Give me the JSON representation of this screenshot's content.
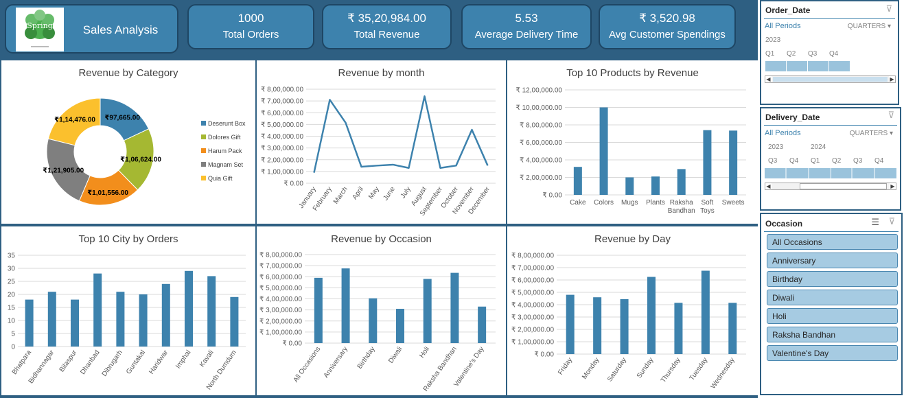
{
  "header": {
    "title": "Sales Analysis",
    "logo_text": "Spring"
  },
  "kpis": [
    {
      "value": "1000",
      "label": "Total Orders"
    },
    {
      "value": "₹ 35,20,984.00",
      "label": "Total Revenue"
    },
    {
      "value": "5.53",
      "label": "Average Delivery Time"
    },
    {
      "value": "₹ 3,520.98",
      "label": "Avg Customer Spendings"
    }
  ],
  "colors": {
    "accent": "#3d82ad",
    "background": "#2e5f82",
    "series": "#3d82ad"
  },
  "chart_data": [
    {
      "id": "revenue-by-category",
      "type": "pie",
      "title": "Revenue by Category",
      "categories": [
        "Deserunt Box",
        "Dolores Gift",
        "Harum Pack",
        "Magnam Set",
        "Quia Gift"
      ],
      "values": [
        97665,
        106624,
        101556,
        121905,
        114476
      ],
      "data_labels": [
        "₹97,665.00",
        "₹1,06,624.00",
        "₹1,01,556.00",
        "₹1,21,905.00",
        "₹1,14,476.00"
      ],
      "colors": [
        "#3d82ad",
        "#a5b832",
        "#f28e1c",
        "#7f7f7f",
        "#fbc02d"
      ],
      "legend": "right"
    },
    {
      "id": "revenue-by-month",
      "type": "line",
      "title": "Revenue by month",
      "categories": [
        "January",
        "February",
        "March",
        "April",
        "May",
        "June",
        "July",
        "August",
        "September",
        "October",
        "November",
        "December"
      ],
      "values": [
        90000,
        710000,
        515000,
        140000,
        150000,
        158000,
        130000,
        740000,
        130000,
        150000,
        455000,
        150000
      ],
      "yticks": [
        "₹ 0.00",
        "₹ 1,00,000.00",
        "₹ 2,00,000.00",
        "₹ 3,00,000.00",
        "₹ 4,00,000.00",
        "₹ 5,00,000.00",
        "₹ 6,00,000.00",
        "₹ 7,00,000.00",
        "₹ 8,00,000.00"
      ],
      "ylim": [
        0,
        800000
      ],
      "grid": true
    },
    {
      "id": "top-products",
      "type": "bar",
      "title": "Top 10 Products by Revenue",
      "categories": [
        "Cake",
        "Colors",
        "Mugs",
        "Plants",
        "Raksha Bandhan",
        "Soft Toys",
        "Sweets"
      ],
      "category_lines": [
        [
          "Cake"
        ],
        [
          "Colors"
        ],
        [
          "Mugs"
        ],
        [
          "Plants"
        ],
        [
          "Raksha",
          "Bandhan"
        ],
        [
          "Soft",
          "Toys"
        ],
        [
          "Sweets"
        ]
      ],
      "values": [
        320000,
        1000000,
        200000,
        210000,
        295000,
        740000,
        735000
      ],
      "yticks": [
        "₹ 0.00",
        "₹ 2,00,000.00",
        "₹ 4,00,000.00",
        "₹ 6,00,000.00",
        "₹ 8,00,000.00",
        "₹ 10,00,000.00",
        "₹ 12,00,000.00"
      ],
      "ylim": [
        0,
        1200000
      ],
      "grid": true
    },
    {
      "id": "top-cities",
      "type": "bar",
      "title": "Top 10 City by Orders",
      "categories": [
        "Bhatpara",
        "Bidhannagar",
        "Bilaspur",
        "Dhanbad",
        "Dibrugarh",
        "Guntakal",
        "Haridwar",
        "Imphal",
        "Kavali",
        "North Dumdum"
      ],
      "values": [
        18,
        21,
        18,
        28,
        21,
        20,
        24,
        29,
        27,
        19
      ],
      "yticks": [
        "0",
        "5",
        "10",
        "15",
        "20",
        "25",
        "30",
        "35"
      ],
      "ylim": [
        0,
        35
      ],
      "grid": true
    },
    {
      "id": "revenue-by-occasion",
      "type": "bar",
      "title": "Revenue by Occasion",
      "categories": [
        "All Occasions",
        "Anniversary",
        "Birthday",
        "Diwali",
        "Holi",
        "Raksha Bandhan",
        "Valentine's Day"
      ],
      "values": [
        590000,
        675000,
        405000,
        310000,
        580000,
        635000,
        330000
      ],
      "yticks": [
        "₹ 0.00",
        "₹ 1,00,000.00",
        "₹ 2,00,000.00",
        "₹ 3,00,000.00",
        "₹ 4,00,000.00",
        "₹ 5,00,000.00",
        "₹ 6,00,000.00",
        "₹ 7,00,000.00",
        "₹ 8,00,000.00"
      ],
      "ylim": [
        0,
        800000
      ],
      "grid": true
    },
    {
      "id": "revenue-by-day",
      "type": "bar",
      "title": "Revenue by Day",
      "categories": [
        "Friday",
        "Monday",
        "Saturday",
        "Sunday",
        "Thursday",
        "Tuesday",
        "Wednesday"
      ],
      "values": [
        480000,
        460000,
        445000,
        625000,
        415000,
        675000,
        415000
      ],
      "yticks": [
        "₹ 0.00",
        "₹ 1,00,000.00",
        "₹ 2,00,000.00",
        "₹ 3,00,000.00",
        "₹ 4,00,000.00",
        "₹ 5,00,000.00",
        "₹ 6,00,000.00",
        "₹ 7,00,000.00",
        "₹ 8,00,000.00"
      ],
      "ylim": [
        0,
        800000
      ],
      "grid": true
    }
  ],
  "slicers": {
    "order_date": {
      "title": "Order_Date",
      "all_periods": "All Periods",
      "level": "QUARTERS",
      "years": [
        "2023"
      ],
      "quarters": [
        "Q1",
        "Q2",
        "Q3",
        "Q4"
      ]
    },
    "delivery_date": {
      "title": "Delivery_Date",
      "all_periods": "All Periods",
      "level": "QUARTERS",
      "years": [
        "2023",
        "2024"
      ],
      "quarters": [
        "Q3",
        "Q4",
        "Q1",
        "Q2",
        "Q3",
        "Q4"
      ]
    },
    "occasion": {
      "title": "Occasion",
      "items": [
        "All Occasions",
        "Anniversary",
        "Birthday",
        "Diwali",
        "Holi",
        "Raksha Bandhan",
        "Valentine's Day"
      ]
    }
  }
}
